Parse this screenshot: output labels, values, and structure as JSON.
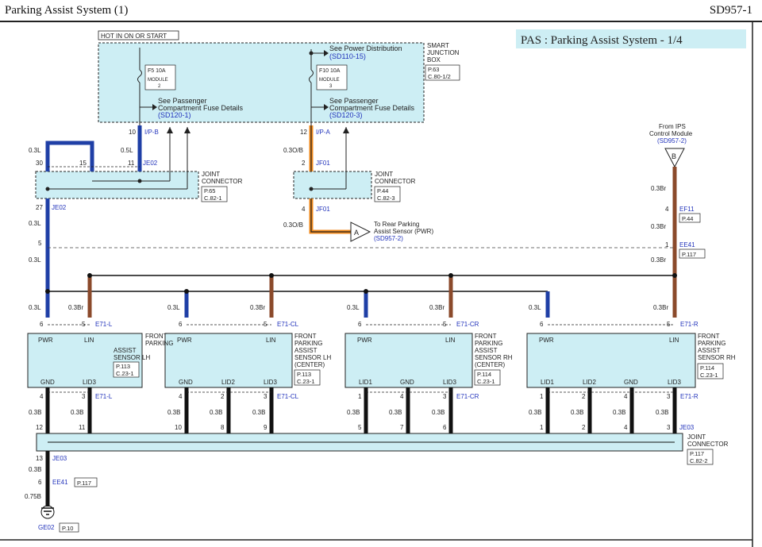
{
  "header": {
    "title": "Parking Assist System (1)",
    "code": "SD957-1"
  },
  "banner": "PAS : Parking Assist System - 1/4",
  "power_label": "HOT IN ON OR START",
  "colors": {
    "panel": "#cdeef4",
    "blue_wire": "#1f3fa6",
    "brown_wire": "#8b4a2b",
    "orange_wire": "#f08a1c",
    "black_wire": "#111111",
    "link": "#2233bb"
  },
  "junction_box": {
    "label_lines": [
      "SMART",
      "JUNCTION",
      "BOX"
    ],
    "ref1": "P.63",
    "ref2": "C.80-1/2",
    "fuse1": {
      "name": "F5 10A",
      "module_lines": [
        "MODULE",
        "2"
      ]
    },
    "fuse2": {
      "name": "F10 10A",
      "module_lines": [
        "MODULE",
        "3"
      ]
    },
    "see_power": "See Power Distribution",
    "see_power_ref": "(SD110-15)",
    "see_pass_line1": "See Passenger",
    "see_pass_line2": "Compartment Fuse Details",
    "see_pass_ref1": "(SD120-1)",
    "see_pass_ref2": "(SD120-3)"
  },
  "joint_connectors": {
    "label_lines": [
      "JOINT",
      "CONNECTOR"
    ],
    "left": {
      "ref1": "P.65",
      "ref2": "C.82-1"
    },
    "mid": {
      "ref1": "P.44",
      "ref2": "C.82-3"
    },
    "bottom": {
      "ref1": "P.117",
      "ref2": "C.82-2"
    }
  },
  "pins": {
    "p10": "10",
    "p12": "12",
    "p30": "30",
    "p15": "15",
    "p11": "11",
    "p2": "2",
    "p27": "27",
    "p4": "4",
    "p5": "5",
    "p1": "1",
    "p6": "6",
    "p3": "3",
    "p13": "13",
    "p7": "7",
    "p8": "8",
    "p9": "9"
  },
  "connector_names": {
    "ip_b": "I/P-B",
    "ip_a": "I/P-A",
    "je02": "JE02",
    "jf01": "JF01",
    "ef11": "EF11",
    "ee41": "EE41",
    "e71_l": "E71-L",
    "e71_cl": "E71-CL",
    "e71_cr": "E71-CR",
    "e71_r": "E71-R",
    "je03": "JE03",
    "ge02": "GE02"
  },
  "wire_labels": {
    "w03l": "0.3L",
    "w05l": "0.5L",
    "w03ob": "0.3O/B",
    "w03br": "0.3Br",
    "w03b": "0.3B",
    "w075b": "0.75B"
  },
  "page_refs": {
    "p44": "P.44",
    "p117": "P.117",
    "p10": "P.10"
  },
  "ips": {
    "line1": "From IPS",
    "line2": "Control Module",
    "ref": "(SD957-2)",
    "marker": "B"
  },
  "rear_sensor": {
    "line1": "To Rear Parking",
    "line2": "Assist Sensor (PWR)",
    "ref": "(SD957-2)",
    "marker": "A"
  },
  "terminals": {
    "pwr": "PWR",
    "lin": "LIN",
    "gnd": "GND",
    "lid1": "LID1",
    "lid2": "LID2",
    "lid3": "LID3"
  },
  "sensors": [
    {
      "lines": [
        "FRONT",
        "PARKING",
        "ASSIST",
        "SENSOR LH"
      ],
      "ref1": "P.113",
      "ref2": "C.23-1"
    },
    {
      "lines": [
        "FRONT",
        "PARKING",
        "ASSIST",
        "SENSOR LH",
        "(CENTER)"
      ],
      "ref1": "P.113",
      "ref2": "C.23-1"
    },
    {
      "lines": [
        "FRONT",
        "PARKING",
        "ASSIST",
        "SENSOR RH",
        "(CENTER)"
      ],
      "ref1": "P.114",
      "ref2": "C.23-1"
    },
    {
      "lines": [
        "FRONT",
        "PARKING",
        "ASSIST",
        "SENSOR RH"
      ],
      "ref1": "P.114",
      "ref2": "C.23-1"
    }
  ]
}
